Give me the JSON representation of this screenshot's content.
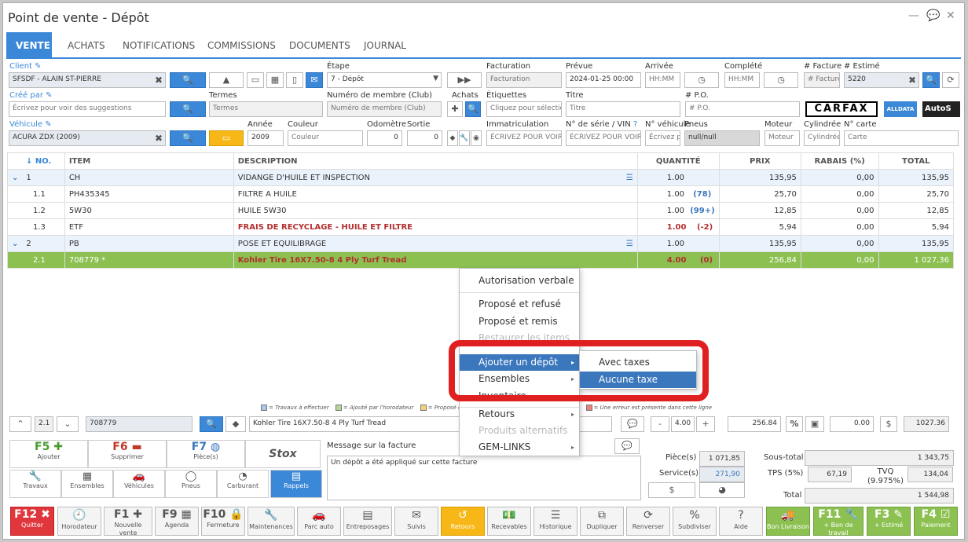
{
  "window": {
    "title": "Point de vente - Dépôt"
  },
  "tabs": [
    "VENTE",
    "ACHATS",
    "NOTIFICATIONS",
    "COMMISSIONS",
    "DOCUMENTS",
    "JOURNAL"
  ],
  "form": {
    "client_label": "Client",
    "client_value": "SFSDF - ALAIN ST-PIERRE",
    "etape_label": "Étape",
    "etape_value": "7 - Dépôt",
    "facturation_label": "Facturation",
    "facturation_ph": "Facturation",
    "prevue_label": "Prévue",
    "prevue_value": "2024-01-25 00:00",
    "arrivee_label": "Arrivée",
    "arrivee_ph": "HH:MM",
    "complete_label": "Complété",
    "complete_ph": "HH:MM",
    "facture_label": "# Facture",
    "facture_ph": "# Facture",
    "estime_label": "# Estimé",
    "estime_value": "5220",
    "cree_label": "Créé par",
    "cree_ph": "Écrivez pour voir des suggestions",
    "termes_label": "Termes",
    "termes_ph": "Termes",
    "membre_label": "Numéro de membre (Club)",
    "membre_ph": "Numéro de membre (Club)",
    "achats_label": "Achats",
    "etiquettes_label": "Étiquettes",
    "etiquettes_ph": "Cliquez pour sélection",
    "titre_label": "Titre",
    "titre_ph": "Titre",
    "po_label": "# P.O.",
    "po_ph": "# P.O.",
    "vehicule_label": "Véhicule",
    "vehicule_value": "ACURA ZDX (2009)",
    "annee_label": "Année",
    "annee_value": "2009",
    "couleur_label": "Couleur",
    "couleur_ph": "Couleur",
    "odometre_label": "Odomètre",
    "odometre_value": "0",
    "sortie_label": "Sortie",
    "sortie_value": "0",
    "immat_label": "Immatriculation",
    "immat_ph": "ÉCRIVEZ POUR VOIR",
    "vin_label": "N° de série / VIN",
    "vin_ph": "ÉCRIVEZ POUR VOIR L",
    "nveh_label": "N° véhicule",
    "nveh_ph": "Écrivez p",
    "pneus_label": "Pneus",
    "pneus_value": "null/null",
    "moteur_label": "Moteur",
    "moteur_ph": "Moteur",
    "cyl_label": "Cylindrée",
    "cyl_ph": "Cylindrée",
    "carte_label": "N° carte",
    "carte_ph": "Carte",
    "logos": [
      "CARFAX",
      "ALLDATA",
      "AutoS"
    ]
  },
  "table": {
    "headers": [
      "NO.",
      "ITEM",
      "DESCRIPTION",
      "QUANTITÉ",
      "PRIX",
      "RABAIS (%)",
      "TOTAL"
    ],
    "rows": [
      {
        "no": "1",
        "item": "CH",
        "desc": "VIDANGE D'HUILE ET INSPECTION",
        "qty": "1.00",
        "stock": "",
        "prix": "135,95",
        "rabais": "0,00",
        "total": "135,95"
      },
      {
        "no": "1.1",
        "item": "PH435345",
        "desc": "FILTRE A HUILE",
        "qty": "1.00",
        "stock": "(78)",
        "prix": "25,70",
        "rabais": "0,00",
        "total": "25,70"
      },
      {
        "no": "1.2",
        "item": "5W30",
        "desc": "HUILE 5W30",
        "qty": "1.00",
        "stock": "(99+)",
        "prix": "12,85",
        "rabais": "0,00",
        "total": "12,85"
      },
      {
        "no": "1.3",
        "item": "ETF",
        "desc": "FRAIS DE RECYCLAGE - HUILE ET FILTRE",
        "qty": "1.00",
        "stock": "(-2)",
        "prix": "5,94",
        "rabais": "0,00",
        "total": "5,94"
      },
      {
        "no": "2",
        "item": "PB",
        "desc": "POSE ET EQUILIBRAGE",
        "qty": "1.00",
        "stock": "",
        "prix": "135,95",
        "rabais": "0,00",
        "total": "135,95"
      },
      {
        "no": "2.1",
        "item": "708779 *",
        "desc": "Kohler Tire 16X7.50-8 4 Ply Turf Tread",
        "qty": "4.00",
        "stock": "(0)",
        "prix": "256,84",
        "rabais": "0,00",
        "total": "1 027,36"
      }
    ]
  },
  "context_menu": {
    "items": [
      "Autorisation verbale",
      "Proposé et refusé",
      "Proposé et remis",
      "Restaurer les items",
      "Ajouter un dépôt",
      "Ensembles",
      "Inventaire",
      "Retours",
      "Produits alternatifs",
      "GEM-LINKS"
    ]
  },
  "submenu": {
    "items": [
      "Avec taxes",
      "Aucune taxe"
    ]
  },
  "legend": [
    "= Travaux à effectuer",
    "= Ajouté par l'horodateur",
    "= Proposé et",
    "= Une erreur est présente dans cette ligne"
  ],
  "edit_bar": {
    "line": "2.1",
    "item": "708779",
    "desc": "Kohler Tire 16X7.50-8 4 Ply Turf Tread",
    "qty": "4.00",
    "price": "256.84",
    "rabais": "0.00",
    "total": "1027.36"
  },
  "actions": [
    {
      "k": "F5",
      "s": "Ajouter"
    },
    {
      "k": "F6",
      "s": "Supprimer"
    },
    {
      "k": "F7",
      "s": "Pièce(s)"
    },
    {
      "k": "Stox",
      "s": ""
    }
  ],
  "actions2": [
    "Travaux",
    "Ensembles",
    "Véhicules",
    "Pneus",
    "Carburant",
    "Rappels"
  ],
  "message": {
    "label": "Message sur la facture",
    "text": "Un dépôt a été appliqué sur cette facture"
  },
  "totals": {
    "pieces_label": "Pièce(s)",
    "pieces": "1 071,85",
    "service_label": "Service(s)",
    "service": "271,90",
    "sous_total_label": "Sous-total",
    "sous_total": "1 343,75",
    "tps_label": "TPS (5%)",
    "tps": "67,19",
    "tvq_label": "TVQ (9.975%)",
    "tvq": "134,04",
    "total_label": "Total",
    "total": "1 544,98"
  },
  "bottom": [
    {
      "k": "F12",
      "s": "Quitter",
      "c": "red",
      "i": "✖"
    },
    {
      "k": "",
      "s": "Horodateur",
      "c": "",
      "i": "🕘"
    },
    {
      "k": "F1",
      "s": "Nouvelle vente",
      "c": "",
      "i": "✚"
    },
    {
      "k": "F9",
      "s": "Agenda",
      "c": "",
      "i": "▦"
    },
    {
      "k": "F10",
      "s": "Fermeture",
      "c": "",
      "i": "🔒"
    },
    {
      "k": "",
      "s": "Maintenances",
      "c": "",
      "i": "🔧"
    },
    {
      "k": "",
      "s": "Parc auto",
      "c": "",
      "i": "🚗"
    },
    {
      "k": "",
      "s": "Entreposages",
      "c": "",
      "i": "▤"
    },
    {
      "k": "",
      "s": "Suivis",
      "c": "",
      "i": "✉"
    },
    {
      "k": "",
      "s": "Retours",
      "c": "yellow",
      "i": "↺"
    },
    {
      "k": "",
      "s": "Recevables",
      "c": "",
      "i": "💵"
    },
    {
      "k": "",
      "s": "Historique",
      "c": "",
      "i": "☰"
    },
    {
      "k": "",
      "s": "Dupliquer",
      "c": "",
      "i": "⧉"
    },
    {
      "k": "",
      "s": "Renverser",
      "c": "",
      "i": "⟳"
    },
    {
      "k": "",
      "s": "Subdiviser",
      "c": "",
      "i": "%"
    },
    {
      "k": "",
      "s": "Aide",
      "c": "",
      "i": "?"
    },
    {
      "k": "",
      "s": "Bon Livraison",
      "c": "green",
      "i": "🚚"
    },
    {
      "k": "F11",
      "s": "+ Bon de travail",
      "c": "green",
      "i": "🔧"
    },
    {
      "k": "F3",
      "s": "+ Estimé",
      "c": "green",
      "i": "✎"
    },
    {
      "k": "F4",
      "s": "Paiement",
      "c": "green",
      "i": "☑"
    }
  ]
}
